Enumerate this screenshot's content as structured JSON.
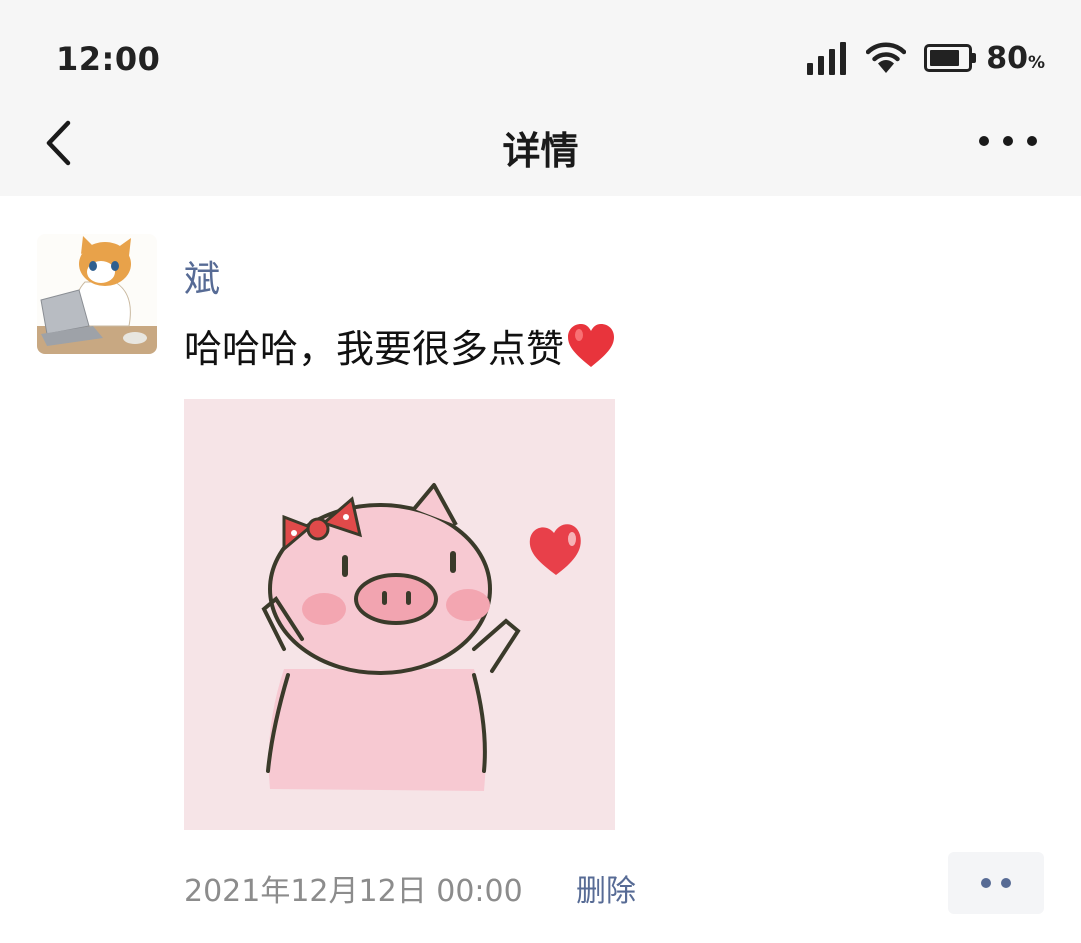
{
  "status_bar": {
    "time": "12:00",
    "battery_level": 0.8,
    "battery_pct": "80",
    "battery_unit": "%",
    "icons": [
      "signal-icon",
      "wifi-icon",
      "battery-icon"
    ]
  },
  "nav": {
    "title": "详情",
    "back_icon": "chevron-left-icon",
    "more_icon": "more-dots-icon"
  },
  "post": {
    "username": "斌",
    "text": "哈哈哈，我要很多点赞",
    "text_emoji": "red-heart-emoji",
    "avatar": "cat-with-laptop-avatar",
    "image": "pink-pig-with-bow-and-heart-sticker",
    "timestamp": "2021年12月12日 00:00",
    "delete_label": "删除",
    "action_icon": "comment-like-dots-icon"
  },
  "colors": {
    "link_blue": "#576b95",
    "header_bg": "#f6f6f6",
    "meta_gray": "#8c8c8c"
  }
}
